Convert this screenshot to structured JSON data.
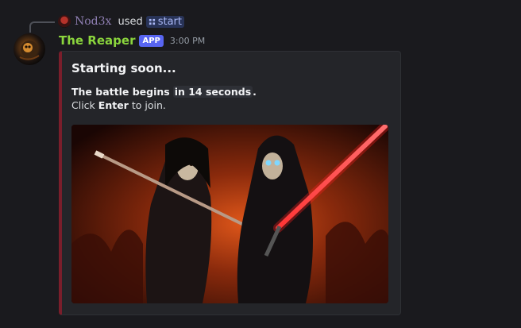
{
  "reply": {
    "user_name": "Nod3x",
    "used_text": "used",
    "command": "start"
  },
  "message": {
    "author": "The Reaper",
    "badge": "APP",
    "timestamp": "3:00 PM"
  },
  "embed": {
    "title": "Starting soon...",
    "line1_prefix": "The battle begins",
    "line1_code": "in 14 seconds",
    "line1_suffix": ".",
    "line2_prefix": "Click",
    "line2_bold": "Enter",
    "line2_suffix": "to join.",
    "accent_color": "#7a1e2b"
  },
  "colors": {
    "background": "#1a1a1e",
    "author_color": "#8bd53d",
    "badge_color": "#5865f2",
    "command_bg": "#283357"
  }
}
